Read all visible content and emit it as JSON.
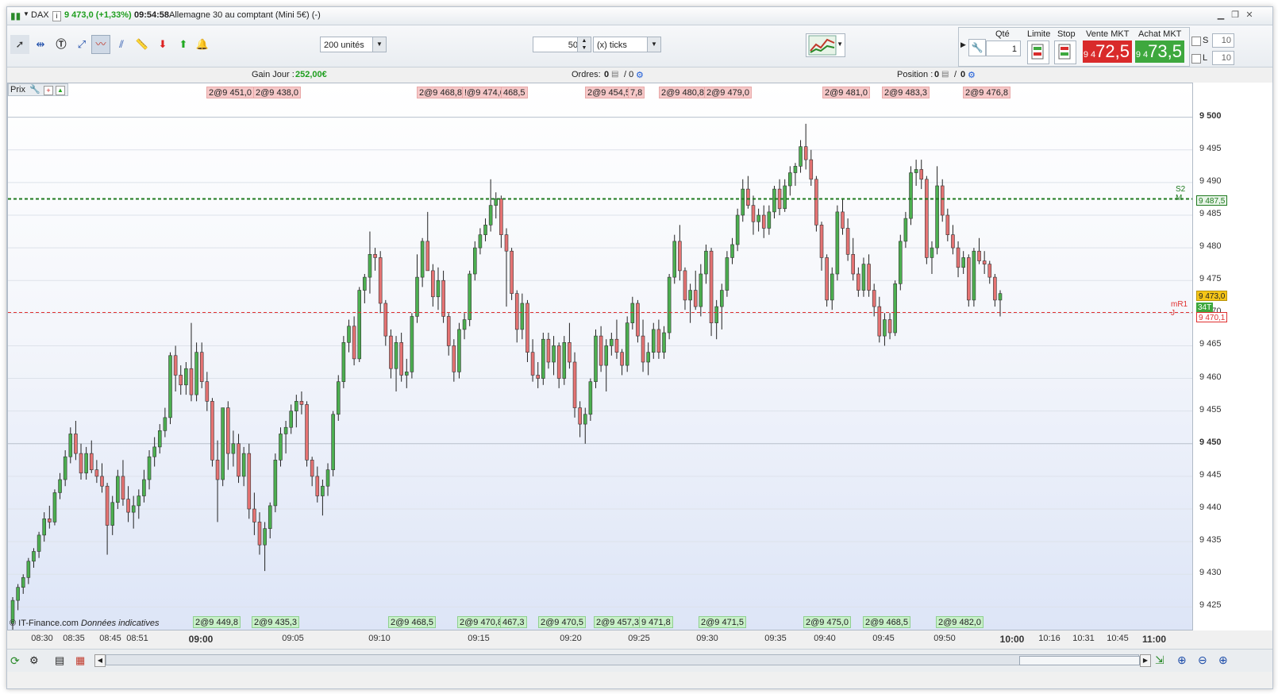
{
  "title_bar": {
    "symbol": "DAX",
    "price_change": "9 473,0 (+1,33%)",
    "time": "09:54:58",
    "instrument": "Allemagne 30 au comptant (Mini 5€) (-)"
  },
  "toolbar": {
    "units_select": "200 unités",
    "ticks_value": "50",
    "ticks_unit": "(x) ticks",
    "qty_label": "Qté",
    "qty_value": "1",
    "limit_label": "Limite",
    "stop_label": "Stop",
    "sell_label": "Vente MKT",
    "sell_prefix": "9 4",
    "sell_value": "72,5",
    "buy_label": "Achat MKT",
    "buy_prefix": "9 4",
    "buy_value": "73,5",
    "s_label": "S",
    "s_value": "10",
    "l_label": "L",
    "l_value": "10"
  },
  "info_bar": {
    "gain_label": "Gain Jour :",
    "gain_value": "252,00€",
    "orders_label": "Ordres:",
    "orders_value": "0",
    "orders_value2": "/ 0",
    "position_label": "Position :",
    "position_value": "0",
    "position_value2": "0"
  },
  "chart_header": {
    "prix_label": "Prix"
  },
  "chart_data": {
    "type": "candlestick",
    "ylim": [
      9422,
      9503
    ],
    "y_ticks": [
      "9 500",
      "9 495",
      "9 490",
      "9 485",
      "9 480",
      "9 475",
      "9 470",
      "9 465",
      "9 460",
      "9 455",
      "9 450",
      "9 445",
      "9 440",
      "9 435",
      "9 430",
      "9 425"
    ],
    "y_tick_values": [
      9500,
      9495,
      9490,
      9485,
      9480,
      9475,
      9470,
      9465,
      9460,
      9455,
      9450,
      9445,
      9440,
      9435,
      9430,
      9425
    ],
    "x_ticks": [
      "08:30",
      "08:35",
      "08:45",
      "08:51",
      "09:00",
      "09:05",
      "09:10",
      "09:15",
      "09:20",
      "09:25",
      "09:30",
      "09:35",
      "09:40",
      "09:45",
      "09:50",
      "10:00",
      "10:16",
      "10:31",
      "10:45",
      "11:00"
    ],
    "x_ticks_bold": [
      "09:00",
      "10:00",
      "11:00"
    ],
    "levels": [
      {
        "name": "S2 M",
        "value": 9487.5,
        "label": "9 487,5",
        "color": "#1e7a1e"
      },
      {
        "name": "mR1 J",
        "value": 9470.1,
        "label": "9 470,1",
        "color": "#e03030"
      }
    ],
    "last_price": {
      "value": 9473.0,
      "label": "9 473,0"
    },
    "countdown_label": "34T",
    "sell_tags": [
      "2@9 451,0",
      "2@9 438,0",
      "2@9 468,8",
      "!@9 474,0",
      "468,5",
      "2@9 454,5",
      "7,8",
      "2@9 480,8",
      "2@9 479,0",
      "2@9 481,0",
      "2@9 483,3",
      "2@9 476,8"
    ],
    "buy_tags": [
      "2@9 449,8",
      "2@9 435,3",
      "2@9 468,5",
      "2@9 470,8",
      "467,3",
      "2@9 470,5",
      "2@9 457,3",
      "9 471,8",
      "2@9 471,5",
      "2@9 475,0",
      "2@9 468,5",
      "2@9 482,0"
    ],
    "candles": [
      [
        9422.5,
        9426.5,
        9421.5,
        9426.0
      ],
      [
        9426.0,
        9428.5,
        9424.5,
        9428.0
      ],
      [
        9428.0,
        9430.0,
        9427.0,
        9429.5
      ],
      [
        9429.5,
        9432.5,
        9428.5,
        9432.0
      ],
      [
        9432.0,
        9434.0,
        9431.0,
        9433.5
      ],
      [
        9433.5,
        9436.5,
        9432.5,
        9436.0
      ],
      [
        9436.0,
        9439.5,
        9435.0,
        9438.5
      ],
      [
        9438.5,
        9440.5,
        9437.0,
        9438.0
      ],
      [
        9438.0,
        9443.0,
        9437.5,
        9442.5
      ],
      [
        9442.5,
        9445.5,
        9441.5,
        9444.5
      ],
      [
        9444.5,
        9449.0,
        9443.5,
        9448.0
      ],
      [
        9448.0,
        9452.5,
        9447.0,
        9451.5
      ],
      [
        9451.5,
        9453.5,
        9447.5,
        9448.5
      ],
      [
        9448.5,
        9450.0,
        9444.5,
        9445.5
      ],
      [
        9445.5,
        9449.5,
        9444.5,
        9448.5
      ],
      [
        9448.5,
        9450.5,
        9445.5,
        9446.0
      ],
      [
        9446.0,
        9447.5,
        9444.0,
        9445.0
      ],
      [
        9445.0,
        9447.0,
        9442.5,
        9443.5
      ],
      [
        9443.5,
        9444.0,
        9433.0,
        9437.5
      ],
      [
        9437.5,
        9442.0,
        9436.0,
        9441.0
      ],
      [
        9441.0,
        9446.0,
        9440.0,
        9445.0
      ],
      [
        9445.0,
        9447.5,
        9440.5,
        9441.5
      ],
      [
        9441.5,
        9443.5,
        9438.0,
        9439.5
      ],
      [
        9439.5,
        9442.0,
        9437.0,
        9440.5
      ],
      [
        9440.5,
        9443.0,
        9438.5,
        9442.0
      ],
      [
        9442.0,
        9446.0,
        9441.0,
        9444.5
      ],
      [
        9444.5,
        9449.0,
        9443.0,
        9448.0
      ],
      [
        9448.0,
        9451.0,
        9446.5,
        9449.5
      ],
      [
        9449.5,
        9453.0,
        9448.5,
        9452.0
      ],
      [
        9452.0,
        9455.5,
        9451.0,
        9454.0
      ],
      [
        9454.0,
        9464.0,
        9453.0,
        9463.5
      ],
      [
        9463.5,
        9465.0,
        9458.0,
        9460.5
      ],
      [
        9460.5,
        9462.0,
        9457.5,
        9459.0
      ],
      [
        9459.0,
        9462.5,
        9457.5,
        9461.5
      ],
      [
        9461.5,
        9468.5,
        9456.5,
        9457.5
      ],
      [
        9457.5,
        9465.5,
        9456.5,
        9464.0
      ],
      [
        9464.0,
        9465.5,
        9458.5,
        9459.5
      ],
      [
        9459.5,
        9461.0,
        9455.0,
        9456.5
      ],
      [
        9456.5,
        9457.0,
        9446.5,
        9447.5
      ],
      [
        9447.5,
        9450.5,
        9438.0,
        9444.5
      ],
      [
        9444.5,
        9454.5,
        9443.5,
        9455.5
      ],
      [
        9455.5,
        9456.5,
        9446.0,
        9448.5
      ],
      [
        9448.5,
        9452.0,
        9446.5,
        9450.0
      ],
      [
        9450.0,
        9451.5,
        9444.0,
        9445.0
      ],
      [
        9445.0,
        9449.5,
        9443.5,
        9448.5
      ],
      [
        9448.5,
        9450.0,
        9438.5,
        9440.0
      ],
      [
        9440.0,
        9442.5,
        9436.0,
        9438.0
      ],
      [
        9438.0,
        9439.5,
        9433.0,
        9434.5
      ],
      [
        9434.5,
        9438.0,
        9430.5,
        9437.0
      ],
      [
        9437.0,
        9441.0,
        9435.5,
        9440.5
      ],
      [
        9440.5,
        9448.5,
        9439.5,
        9447.5
      ],
      [
        9447.5,
        9452.5,
        9446.5,
        9451.5
      ],
      [
        9451.5,
        9453.5,
        9448.5,
        9452.5
      ],
      [
        9452.5,
        9456.0,
        9451.5,
        9455.0
      ],
      [
        9455.0,
        9457.5,
        9452.5,
        9456.5
      ],
      [
        9456.5,
        9458.0,
        9454.5,
        9456.0
      ],
      [
        9456.0,
        9456.5,
        9446.5,
        9447.5
      ],
      [
        9447.5,
        9448.0,
        9443.5,
        9445.0
      ],
      [
        9445.0,
        9446.5,
        9441.0,
        9442.0
      ],
      [
        9442.0,
        9444.5,
        9439.0,
        9443.5
      ],
      [
        9443.5,
        9447.0,
        9442.0,
        9446.0
      ],
      [
        9446.0,
        9455.0,
        9445.0,
        9454.5
      ],
      [
        9454.5,
        9460.5,
        9453.5,
        9459.5
      ],
      [
        9459.5,
        9466.5,
        9458.5,
        9465.5
      ],
      [
        9465.5,
        9469.0,
        9464.0,
        9468.0
      ],
      [
        9468.0,
        9469.5,
        9462.0,
        9463.0
      ],
      [
        9463.0,
        9474.0,
        9462.5,
        9473.5
      ],
      [
        9473.5,
        9476.0,
        9471.5,
        9475.5
      ],
      [
        9475.5,
        9482.5,
        9473.0,
        9479.0
      ],
      [
        9479.0,
        9480.0,
        9476.5,
        9478.5
      ],
      [
        9478.5,
        9479.5,
        9470.0,
        9471.5
      ],
      [
        9471.5,
        9472.0,
        9465.0,
        9466.5
      ],
      [
        9466.5,
        9467.5,
        9460.0,
        9461.5
      ],
      [
        9461.5,
        9466.5,
        9458.0,
        9465.5
      ],
      [
        9465.5,
        9467.0,
        9459.5,
        9460.5
      ],
      [
        9460.5,
        9463.0,
        9458.5,
        9461.0
      ],
      [
        9461.0,
        9470.0,
        9460.0,
        9469.5
      ],
      [
        9469.5,
        9479.0,
        9468.5,
        9475.5
      ],
      [
        9475.5,
        9481.5,
        9474.0,
        9481.0
      ],
      [
        9481.0,
        9485.5,
        9479.5,
        9476.5
      ],
      [
        9476.5,
        9477.5,
        9471.0,
        9472.5
      ],
      [
        9472.5,
        9477.0,
        9470.5,
        9475.0
      ],
      [
        9475.0,
        9476.5,
        9468.5,
        9469.5
      ],
      [
        9469.5,
        9470.0,
        9463.5,
        9465.0
      ],
      [
        9465.0,
        9466.0,
        9459.5,
        9461.0
      ],
      [
        9461.0,
        9468.5,
        9460.0,
        9467.5
      ],
      [
        9467.5,
        9470.0,
        9466.0,
        9469.0
      ],
      [
        9469.0,
        9476.5,
        9468.0,
        9476.0
      ],
      [
        9476.0,
        9481.0,
        9475.0,
        9480.0
      ],
      [
        9480.0,
        9483.0,
        9479.0,
        9482.0
      ],
      [
        9482.0,
        9484.5,
        9481.0,
        9483.5
      ],
      [
        9483.5,
        9490.5,
        9482.5,
        9486.5
      ],
      [
        9486.5,
        9488.5,
        9484.5,
        9487.5
      ],
      [
        9487.5,
        9488.0,
        9480.0,
        9482.0
      ],
      [
        9482.0,
        9483.0,
        9471.0,
        9479.5
      ],
      [
        9479.5,
        9480.0,
        9472.0,
        9473.0
      ],
      [
        9473.0,
        9473.5,
        9465.5,
        9467.5
      ],
      [
        9467.5,
        9473.0,
        9466.0,
        9471.5
      ],
      [
        9471.5,
        9472.0,
        9462.5,
        9464.0
      ],
      [
        9464.0,
        9466.0,
        9459.5,
        9460.5
      ],
      [
        9460.5,
        9462.5,
        9458.5,
        9460.0
      ],
      [
        9460.0,
        9467.0,
        9459.0,
        9466.0
      ],
      [
        9466.0,
        9467.0,
        9461.5,
        9462.5
      ],
      [
        9462.5,
        9466.5,
        9460.5,
        9465.0
      ],
      [
        9465.0,
        9465.5,
        9458.5,
        9460.0
      ],
      [
        9460.0,
        9466.5,
        9459.0,
        9465.5
      ],
      [
        9465.5,
        9468.5,
        9461.5,
        9462.5
      ],
      [
        9462.5,
        9464.0,
        9454.0,
        9455.5
      ],
      [
        9455.5,
        9456.5,
        9451.0,
        9453.0
      ],
      [
        9453.0,
        9455.5,
        9450.0,
        9454.5
      ],
      [
        9454.5,
        9460.0,
        9453.5,
        9459.5
      ],
      [
        9459.5,
        9467.5,
        9458.5,
        9466.5
      ],
      [
        9466.5,
        9468.0,
        9461.0,
        9462.0
      ],
      [
        9462.0,
        9466.0,
        9458.0,
        9465.0
      ],
      [
        9465.0,
        9467.0,
        9463.5,
        9466.0
      ],
      [
        9466.0,
        9469.0,
        9463.0,
        9464.0
      ],
      [
        9464.0,
        9464.5,
        9460.5,
        9462.0
      ],
      [
        9462.0,
        9469.5,
        9461.0,
        9468.5
      ],
      [
        9468.5,
        9472.5,
        9467.5,
        9471.5
      ],
      [
        9471.5,
        9472.0,
        9465.5,
        9466.5
      ],
      [
        9466.5,
        9469.0,
        9461.0,
        9462.5
      ],
      [
        9462.5,
        9465.5,
        9460.5,
        9464.0
      ],
      [
        9464.0,
        9468.5,
        9463.0,
        9467.5
      ],
      [
        9467.5,
        9469.0,
        9463.0,
        9464.0
      ],
      [
        9464.0,
        9468.0,
        9463.0,
        9467.0
      ],
      [
        9467.0,
        9476.0,
        9466.0,
        9475.5
      ],
      [
        9475.5,
        9482.0,
        9474.5,
        9481.0
      ],
      [
        9481.0,
        9483.5,
        9475.0,
        9476.5
      ],
      [
        9476.5,
        9477.0,
        9470.5,
        9472.0
      ],
      [
        9472.0,
        9474.5,
        9468.5,
        9473.5
      ],
      [
        9473.5,
        9476.5,
        9470.5,
        9471.0
      ],
      [
        9471.0,
        9477.5,
        9469.5,
        9476.0
      ],
      [
        9476.0,
        9480.5,
        9474.5,
        9479.5
      ],
      [
        9479.5,
        9480.0,
        9466.5,
        9468.5
      ],
      [
        9468.5,
        9472.0,
        9466.0,
        9471.0
      ],
      [
        9471.0,
        9474.5,
        9467.5,
        9473.5
      ],
      [
        9473.5,
        9479.5,
        9472.5,
        9478.5
      ],
      [
        9478.5,
        9481.5,
        9477.5,
        9480.5
      ],
      [
        9480.5,
        9486.0,
        9479.5,
        9485.0
      ],
      [
        9485.0,
        9490.5,
        9484.0,
        9489.0
      ],
      [
        9489.0,
        9491.0,
        9486.0,
        9486.5
      ],
      [
        9486.5,
        9488.0,
        9482.0,
        9484.0
      ],
      [
        9484.0,
        9486.0,
        9482.5,
        9485.0
      ],
      [
        9485.0,
        9486.5,
        9481.5,
        9483.0
      ],
      [
        9483.0,
        9486.5,
        9482.0,
        9485.5
      ],
      [
        9485.5,
        9489.5,
        9484.5,
        9489.0
      ],
      [
        9489.0,
        9490.5,
        9485.0,
        9486.0
      ],
      [
        9486.0,
        9490.5,
        9485.5,
        9489.5
      ],
      [
        9489.5,
        9492.5,
        9488.0,
        9491.5
      ],
      [
        9491.5,
        9493.0,
        9489.5,
        9492.5
      ],
      [
        9492.5,
        9496.5,
        9491.5,
        9495.5
      ],
      [
        9495.5,
        9499.0,
        9492.0,
        9493.5
      ],
      [
        9493.5,
        9495.0,
        9489.5,
        9490.5
      ],
      [
        9490.5,
        9491.0,
        9482.5,
        9483.5
      ],
      [
        9483.5,
        9484.0,
        9476.5,
        9478.5
      ],
      [
        9478.5,
        9479.0,
        9471.0,
        9472.0
      ],
      [
        9472.0,
        9477.0,
        9470.5,
        9476.0
      ],
      [
        9476.0,
        9486.5,
        9475.0,
        9485.5
      ],
      [
        9485.5,
        9487.5,
        9482.0,
        9483.0
      ],
      [
        9483.0,
        9484.5,
        9478.0,
        9479.0
      ],
      [
        9479.0,
        9481.5,
        9475.0,
        9476.0
      ],
      [
        9476.0,
        9477.0,
        9472.5,
        9473.5
      ],
      [
        9473.5,
        9478.5,
        9472.5,
        9477.5
      ],
      [
        9477.5,
        9479.0,
        9472.5,
        9473.5
      ],
      [
        9473.5,
        9474.5,
        9469.5,
        9471.0
      ],
      [
        9471.0,
        9472.5,
        9465.5,
        9466.5
      ],
      [
        9466.5,
        9470.0,
        9465.0,
        9469.0
      ],
      [
        9469.0,
        9470.0,
        9466.0,
        9467.0
      ],
      [
        9467.0,
        9475.0,
        9466.5,
        9474.5
      ],
      [
        9474.5,
        9482.0,
        9473.5,
        9481.0
      ],
      [
        9481.0,
        9485.5,
        9480.0,
        9484.5
      ],
      [
        9484.5,
        9492.5,
        9483.5,
        9491.5
      ],
      [
        9491.5,
        9493.5,
        9489.5,
        9492.0
      ],
      [
        9492.0,
        9493.5,
        9489.0,
        9490.5
      ],
      [
        9490.5,
        9491.0,
        9477.5,
        9478.5
      ],
      [
        9478.5,
        9481.0,
        9476.0,
        9480.0
      ],
      [
        9480.0,
        9492.5,
        9479.0,
        9489.5
      ],
      [
        9489.5,
        9490.5,
        9484.0,
        9485.0
      ],
      [
        9485.0,
        9486.0,
        9481.0,
        9482.0
      ],
      [
        9482.0,
        9483.5,
        9479.0,
        9480.0
      ],
      [
        9480.0,
        9481.0,
        9475.5,
        9477.0
      ],
      [
        9477.0,
        9479.5,
        9476.0,
        9478.5
      ],
      [
        9478.5,
        9479.0,
        9471.0,
        9472.0
      ],
      [
        9472.0,
        9480.0,
        9471.0,
        9479.5
      ],
      [
        9479.5,
        9481.5,
        9477.5,
        9478.0
      ],
      [
        9478.0,
        9479.5,
        9476.0,
        9477.5
      ],
      [
        9477.5,
        9478.0,
        9474.5,
        9475.5
      ],
      [
        9475.5,
        9476.0,
        9471.0,
        9472.0
      ],
      [
        9472.0,
        9473.5,
        9469.5,
        9473.0
      ]
    ]
  },
  "footer": {
    "watermark": "© IT-Finance.com",
    "watermark_note": "Données indicatives"
  },
  "colors": {
    "candle_up": "#4caf50",
    "candle_down": "#e57373",
    "sell_button": "#d92b2b",
    "buy_button": "#3ea83e",
    "gain": "#1e9e1e",
    "title_change": "#1e9e1e"
  }
}
